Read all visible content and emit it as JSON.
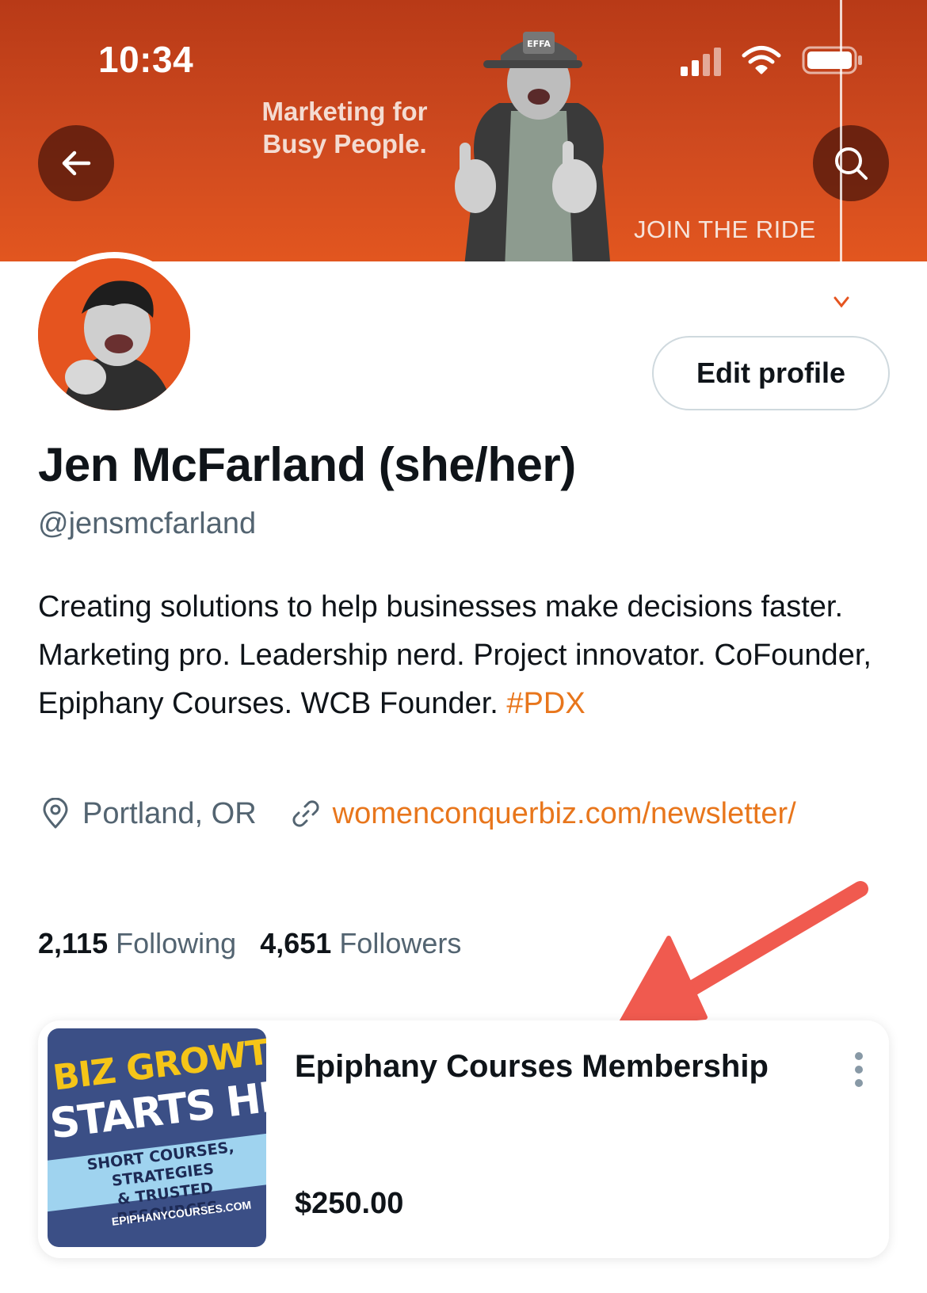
{
  "status_bar": {
    "time": "10:34"
  },
  "banner": {
    "tagline_line1": "Marketing for",
    "tagline_line2": "Busy People.",
    "cta": "JOIN THE RIDE",
    "cap_text": "EFFA"
  },
  "profile": {
    "edit_label": "Edit profile",
    "name": "Jen McFarland (she/her)",
    "handle": "@jensmcfarland",
    "bio_text": "Creating solutions to help businesses make decisions faster. Marketing pro. Leadership nerd. Project innovator. CoFounder, Epiphany Courses. WCB Founder.",
    "bio_hashtag": "#PDX",
    "location": "Portland, OR",
    "website": "womenconquerbiz.com/newsletter/",
    "following_count": "2,115",
    "following_label": "Following",
    "followers_count": "4,651",
    "followers_label": "Followers"
  },
  "shop_card": {
    "title": "Epiphany Courses Membership",
    "price": "$250.00",
    "image": {
      "line1": "BIZ GROWTH",
      "line2": "STARTS HERE",
      "band_line1": "SHORT COURSES, STRATEGIES",
      "band_line2": "& TRUSTED RESOURCES",
      "url": "EPIPHANYCOURSES.COM"
    }
  },
  "colors": {
    "banner": "#cf4a1f",
    "accent_link": "#e8761c",
    "annotation_arrow": "#f05a4f",
    "muted_text": "#536471"
  }
}
